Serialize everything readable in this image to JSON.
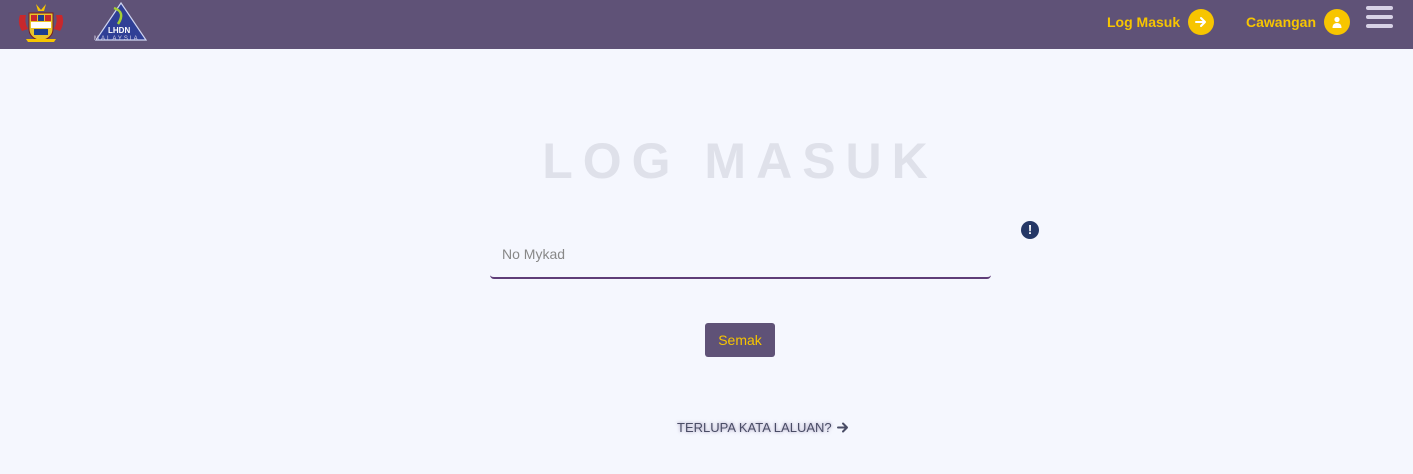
{
  "header": {
    "crest_alt": "Jata Negara",
    "logo": {
      "main": "LHDN",
      "sub": "MALAYSIA"
    },
    "nav": {
      "login_label": "Log Masuk",
      "login_icon": "arrow-right-circle-icon",
      "branch_label": "Cawangan",
      "branch_icon": "person-circle-icon"
    },
    "menu_icon": "hamburger-menu-icon"
  },
  "main": {
    "title": "LOG MASUK",
    "mykad_placeholder": "No Mykad",
    "info_icon_glyph": "!",
    "submit_label": "Semak",
    "forgot_label": "TERLUPA KATA LALUAN?"
  },
  "colors": {
    "header_bg": "#5f5277",
    "accent_yellow": "#f7c500",
    "page_bg": "#f5f7fe",
    "input_underline": "#5f3d78",
    "info_icon_bg": "#243766"
  }
}
